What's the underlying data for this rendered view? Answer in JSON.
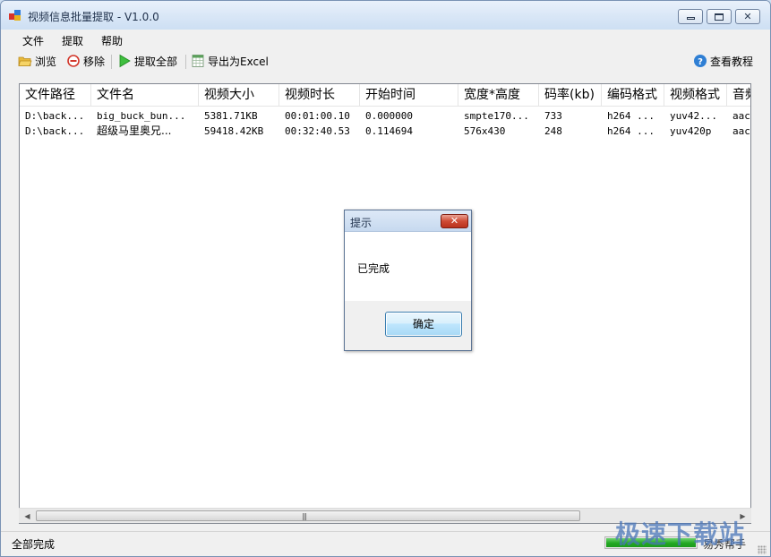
{
  "window": {
    "title": "视频信息批量提取 - V1.0.0"
  },
  "menu": {
    "items": [
      "文件",
      "提取",
      "帮助"
    ]
  },
  "toolbar": {
    "browse": "浏览",
    "remove": "移除",
    "extract_all": "提取全部",
    "export_excel": "导出为Excel",
    "tutorial": "查看教程"
  },
  "table": {
    "headers": [
      "文件路径",
      "文件名",
      "视频大小",
      "视频时长",
      "开始时间",
      "宽度*高度",
      "码率(kb)",
      "编码格式",
      "视频格式",
      "音频"
    ],
    "rows": [
      [
        "D:\\back...",
        "big_buck_bun...",
        "5381.71KB",
        "00:01:00.10",
        "0.000000",
        "smpte170...",
        "733",
        "h264 ...",
        "yuv42...",
        "aac"
      ],
      [
        "D:\\back...",
        "超级马里奥兄...",
        "59418.42KB",
        "00:32:40.53",
        "0.114694",
        "576x430",
        "248",
        "h264 ...",
        "yuv420p",
        "aac"
      ]
    ]
  },
  "status": {
    "text": "全部完成",
    "progress": 1.0,
    "right_text": "易秀帮手"
  },
  "dialog": {
    "title": "提示",
    "message": "已完成",
    "ok_label": "确定",
    "close_glyph": "✕"
  },
  "watermark": "极速下载站",
  "colors": {
    "progress": "#23a823",
    "dialog_close": "#cf4b35",
    "title_bar": "#dbe8f7"
  }
}
